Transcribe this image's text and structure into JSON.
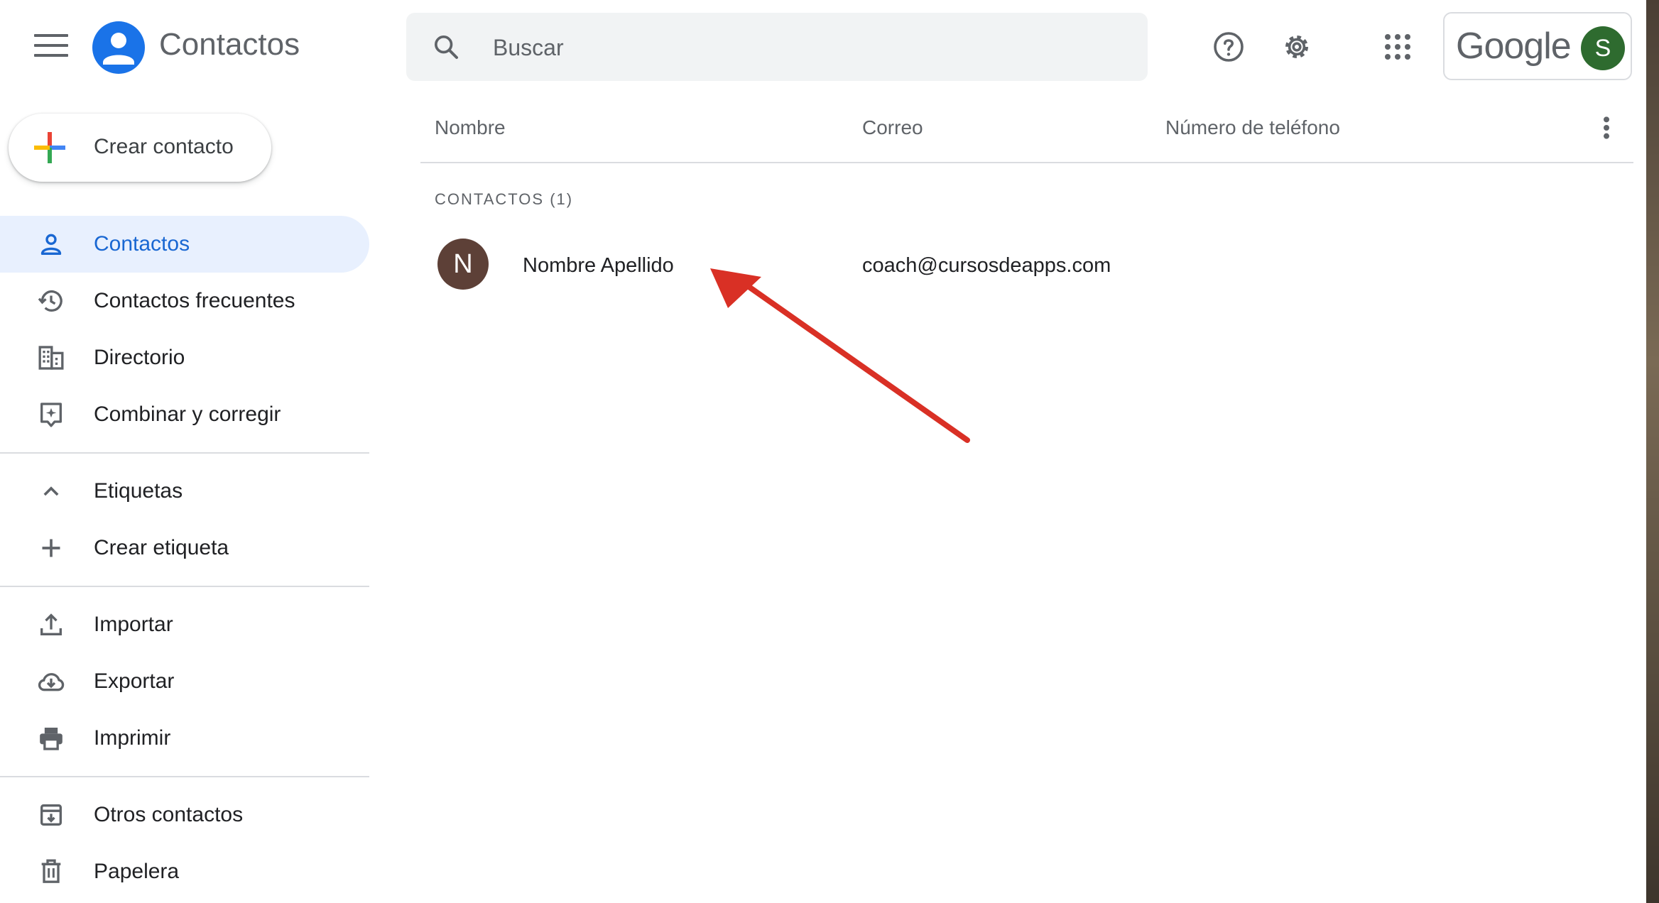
{
  "header": {
    "app_title": "Contactos",
    "search_placeholder": "Buscar",
    "wordmark": "Google",
    "avatar_initial": "S",
    "avatar_color": "#2e6b2f"
  },
  "sidebar": {
    "create_label": "Crear contacto",
    "groups": [
      [
        {
          "label": "Contactos",
          "icon": "person-icon",
          "active": true
        },
        {
          "label": "Contactos frecuentes",
          "icon": "history-icon"
        },
        {
          "label": "Directorio",
          "icon": "domain-icon"
        },
        {
          "label": "Combinar y corregir",
          "icon": "merge-fix-icon"
        }
      ],
      [
        {
          "label": "Etiquetas",
          "icon": "chevron-up-icon"
        },
        {
          "label": "Crear etiqueta",
          "icon": "plus-icon"
        }
      ],
      [
        {
          "label": "Importar",
          "icon": "upload-icon"
        },
        {
          "label": "Exportar",
          "icon": "cloud-download-icon"
        },
        {
          "label": "Imprimir",
          "icon": "printer-icon"
        }
      ],
      [
        {
          "label": "Otros contactos",
          "icon": "archive-icon"
        },
        {
          "label": "Papelera",
          "icon": "trash-icon"
        }
      ]
    ]
  },
  "table": {
    "headers": {
      "name": "Nombre",
      "email": "Correo",
      "phone": "Número de teléfono"
    },
    "section_label": "CONTACTOS (1)",
    "rows": [
      {
        "initial": "N",
        "name": "Nombre Apellido",
        "email": "coach@cursosdeapps.com",
        "phone": "",
        "avatar_color": "#5d4037"
      }
    ]
  },
  "colors": {
    "accent": "#1a73e8",
    "active_bg": "#e8f0fe",
    "active_text": "#1967d2",
    "arrow": "#d93025"
  }
}
